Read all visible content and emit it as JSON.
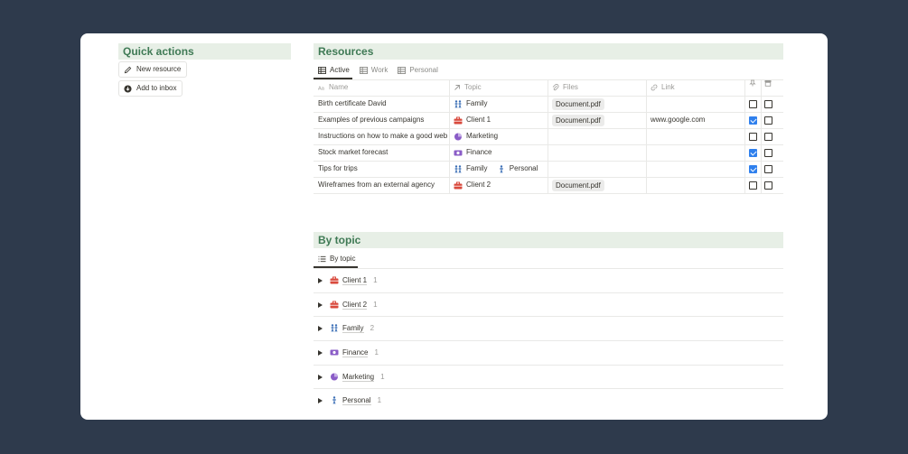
{
  "quick_actions": {
    "title": "Quick actions",
    "buttons": [
      {
        "label": "New resource",
        "icon": "pencil-icon"
      },
      {
        "label": "Add to inbox",
        "icon": "download-circle-icon"
      }
    ]
  },
  "resources": {
    "title": "Resources",
    "tabs": [
      {
        "label": "Active",
        "active": true
      },
      {
        "label": "Work",
        "active": false
      },
      {
        "label": "Personal",
        "active": false
      }
    ],
    "columns": {
      "name": "Name",
      "topic": "Topic",
      "files": "Files",
      "link": "Link"
    },
    "rows": [
      {
        "name": "Birth certificate David",
        "topics": [
          {
            "label": "Family",
            "icon": "family-icon"
          }
        ],
        "file": "Document.pdf",
        "link": "",
        "pin": false,
        "archive": false
      },
      {
        "name": "Examples of previous campaigns",
        "topics": [
          {
            "label": "Client 1",
            "icon": "briefcase-icon"
          }
        ],
        "file": "Document.pdf",
        "link": "www.google.com",
        "pin": true,
        "archive": false
      },
      {
        "name": "Instructions on how to make a good webs",
        "topics": [
          {
            "label": "Marketing",
            "icon": "pie-chart-icon"
          }
        ],
        "file": "",
        "link": "",
        "pin": false,
        "archive": false
      },
      {
        "name": "Stock market forecast",
        "topics": [
          {
            "label": "Finance",
            "icon": "money-icon"
          }
        ],
        "file": "",
        "link": "",
        "pin": true,
        "archive": false
      },
      {
        "name": "Tips for trips",
        "topics": [
          {
            "label": "Family",
            "icon": "family-icon"
          },
          {
            "label": "Personal",
            "icon": "person-icon"
          }
        ],
        "file": "",
        "link": "",
        "pin": true,
        "archive": false
      },
      {
        "name": "Wireframes from an external agency",
        "topics": [
          {
            "label": "Client 2",
            "icon": "briefcase-icon"
          }
        ],
        "file": "Document.pdf",
        "link": "",
        "pin": false,
        "archive": false
      }
    ]
  },
  "by_topic": {
    "title": "By topic",
    "tab": "By topic",
    "groups": [
      {
        "label": "Client 1",
        "count": "1",
        "icon": "briefcase-icon"
      },
      {
        "label": "Client 2",
        "count": "1",
        "icon": "briefcase-icon"
      },
      {
        "label": "Family",
        "count": "2",
        "icon": "family-icon"
      },
      {
        "label": "Finance",
        "count": "1",
        "icon": "money-icon"
      },
      {
        "label": "Marketing",
        "count": "1",
        "icon": "pie-chart-icon"
      },
      {
        "label": "Personal",
        "count": "1",
        "icon": "person-icon"
      }
    ]
  },
  "colors": {
    "background": "#2e3a4c",
    "section_header_bg": "#e7efe6",
    "section_header_text": "#3f7a55",
    "checkbox_checked": "#2f80ed"
  }
}
